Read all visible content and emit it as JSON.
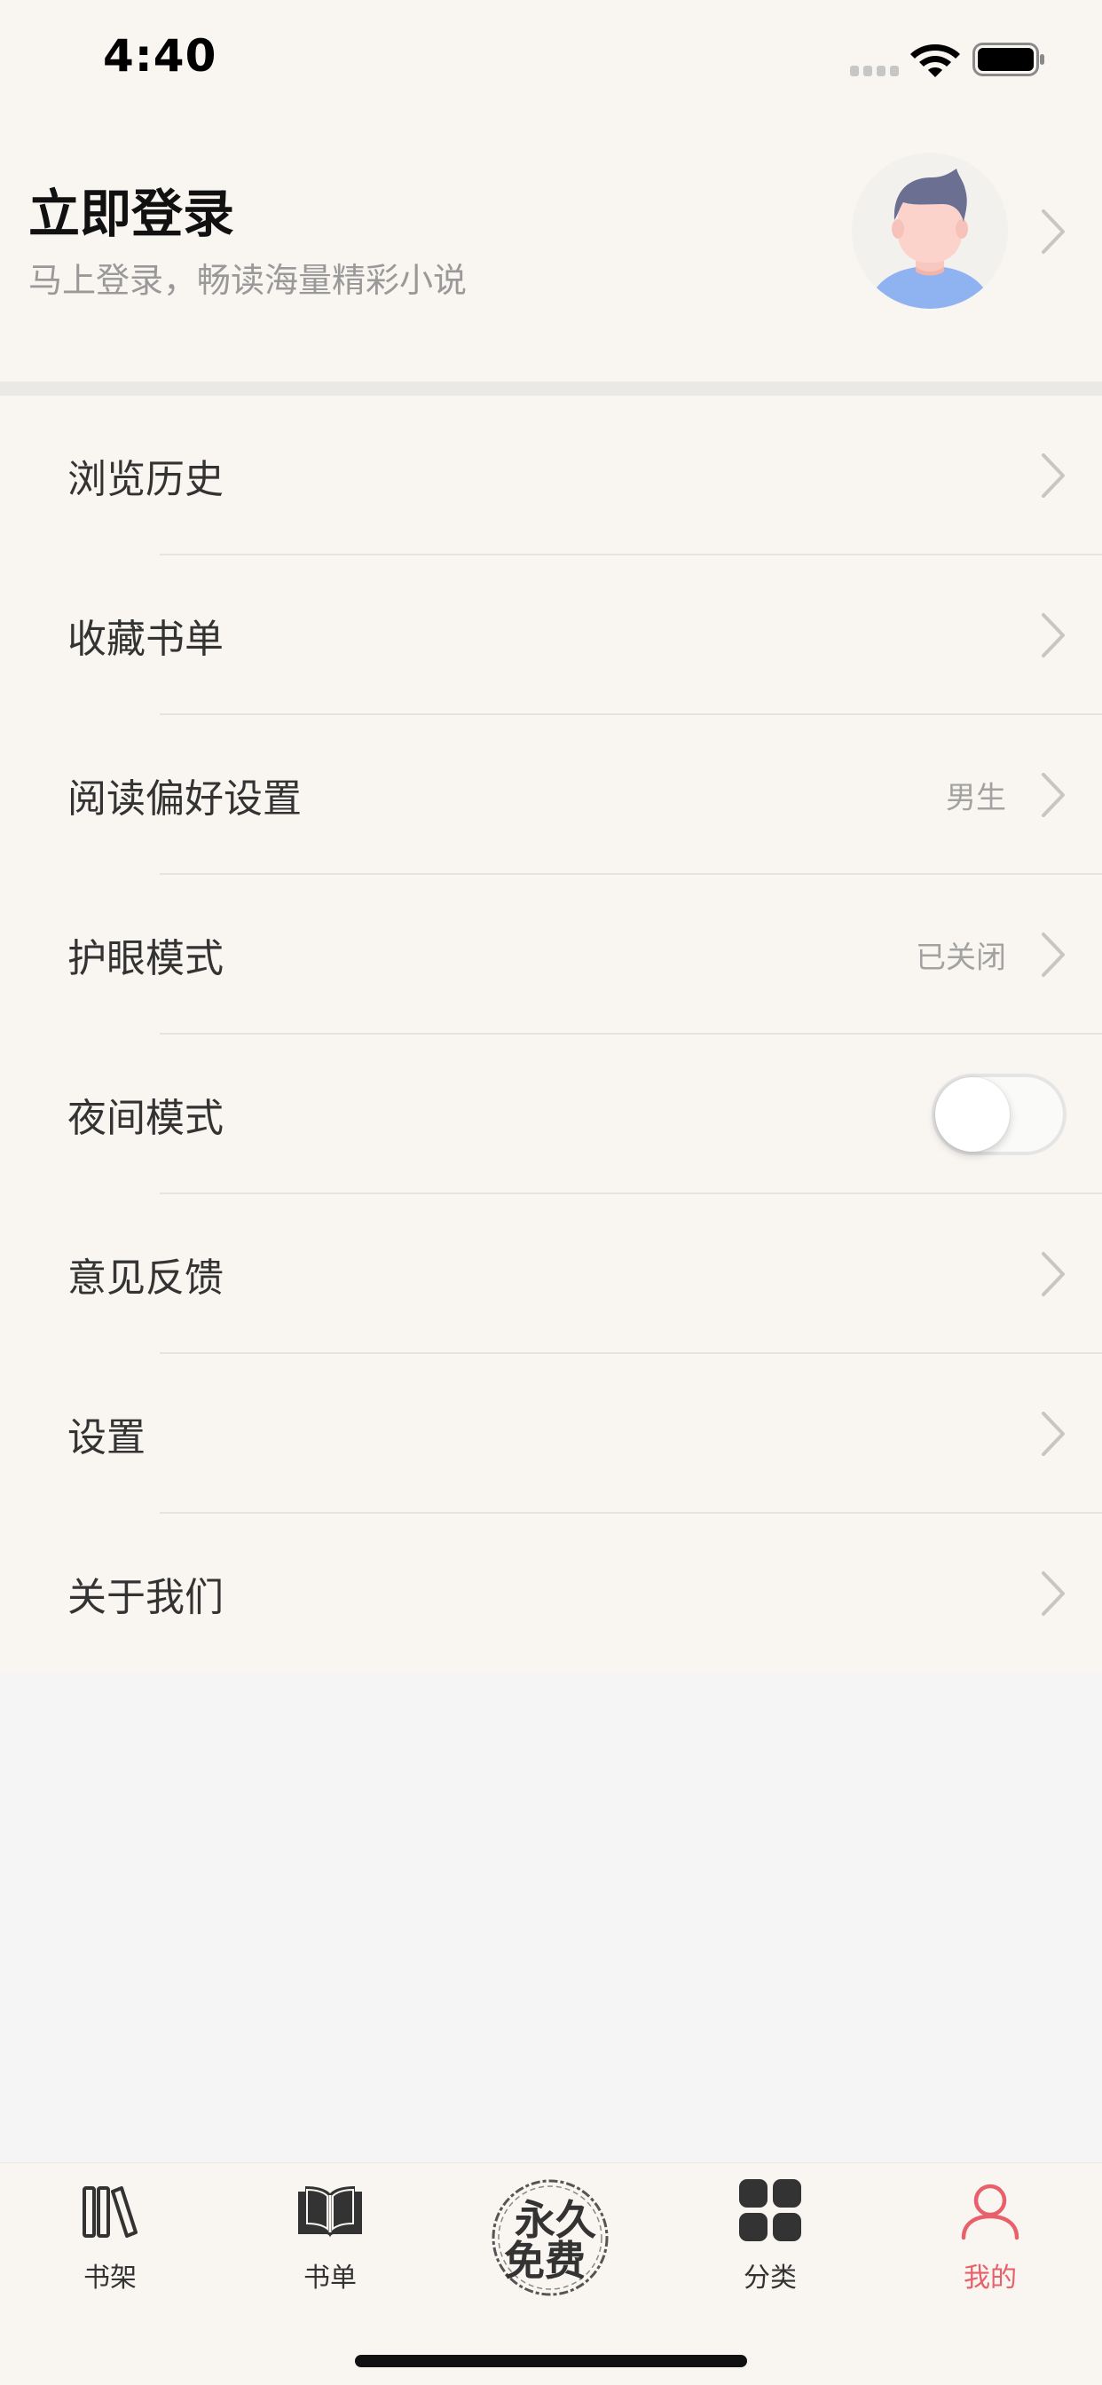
{
  "status_bar": {
    "time": "4:40"
  },
  "profile": {
    "title": "立即登录",
    "subtitle": "马上登录，畅读海量精彩小说"
  },
  "menu": {
    "items": [
      {
        "label": "浏览历史",
        "value": ""
      },
      {
        "label": "收藏书单",
        "value": ""
      },
      {
        "label": "阅读偏好设置",
        "value": "男生"
      },
      {
        "label": "护眼模式",
        "value": "已关闭"
      },
      {
        "label": "夜间模式",
        "value": "",
        "toggle": false
      },
      {
        "label": "意见反馈",
        "value": ""
      },
      {
        "label": "设置",
        "value": ""
      },
      {
        "label": "关于我们",
        "value": ""
      }
    ]
  },
  "tab_bar": {
    "tabs": [
      {
        "label": "书架",
        "icon": "bookshelf-icon"
      },
      {
        "label": "书单",
        "icon": "open-book-icon"
      },
      {
        "label": "永久免费",
        "icon": "free-stamp-icon"
      },
      {
        "label": "分类",
        "icon": "grid-icon"
      },
      {
        "label": "我的",
        "icon": "user-icon"
      }
    ],
    "free_line1": "永久",
    "free_line2": "免费",
    "active_index": 4
  },
  "colors": {
    "background": "#f9f5f0",
    "page_background": "#f5f5f5",
    "accent": "#e8606a",
    "secondary_text": "#a2a2a2"
  }
}
